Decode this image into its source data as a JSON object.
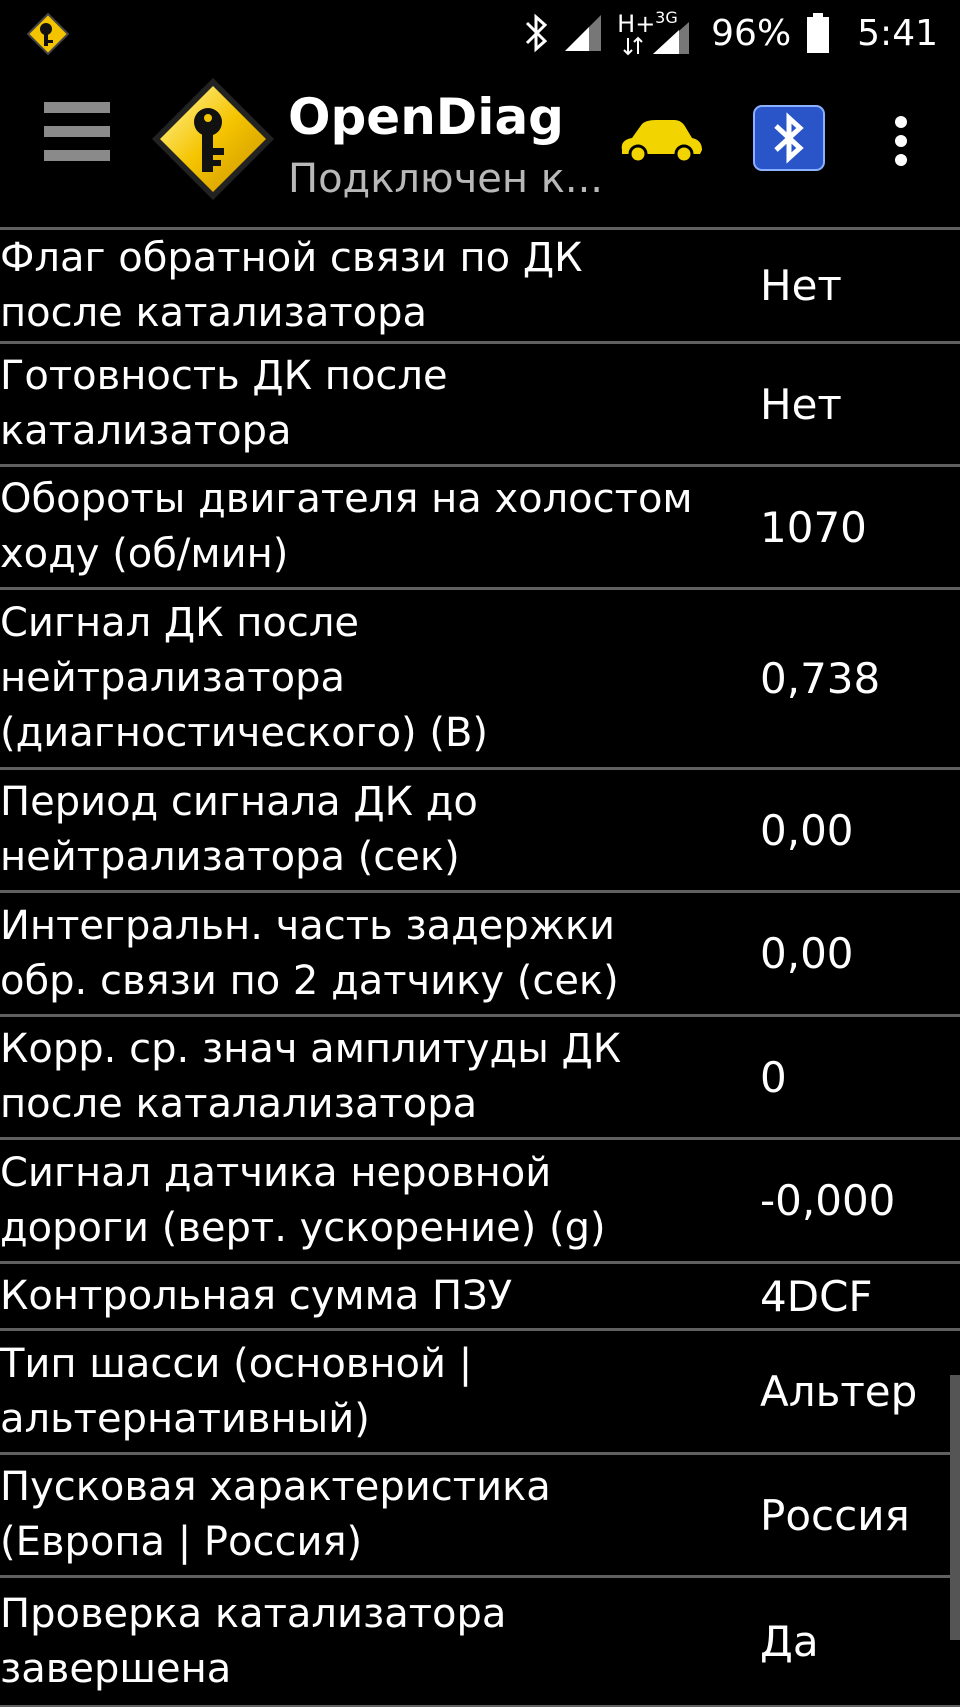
{
  "status_bar": {
    "battery_percent": "96%",
    "time": "5:41",
    "network_label": "H+",
    "network_3g": "3G"
  },
  "action_bar": {
    "title": "OpenDiag",
    "subtitle": "Подключен к..."
  },
  "colors": {
    "background": "#000000",
    "divider": "#606060",
    "car_icon": "#f2d400",
    "logo_yellow": "#f5c400",
    "bluetooth_blue": "#2a55c8"
  },
  "rows": [
    {
      "label": "Флаг обратной связи по ДК\nпосле катализатора",
      "value": "Нет",
      "height": 114
    },
    {
      "label": "Готовность ДК после\nкатализатора",
      "value": "Нет",
      "height": 123
    },
    {
      "label": "Обороты двигателя на холостом\nходу (об/мин)",
      "value": "1070",
      "height": 123
    },
    {
      "label": "Сигнал ДК после\nнейтрализатора\n(диагностического) (В)",
      "value": "0,738",
      "height": 180
    },
    {
      "label": "Период сигнала ДК до\nнейтрализатора (сек)",
      "value": "0,00",
      "height": 123
    },
    {
      "label": "Интегральн. часть задержки\nобр. связи по 2 датчику (сек)",
      "value": "0,00",
      "height": 124
    },
    {
      "label": "Корр. ср. знач амплитуды ДК\nпосле каталализатора",
      "value": "0",
      "height": 123
    },
    {
      "label": "Сигнал датчика неровной\nдороги (верт. ускорение) (g)",
      "value": "-0,000",
      "height": 124
    },
    {
      "label": "Контрольная сумма ПЗУ",
      "value": "4DCF",
      "height": 67
    },
    {
      "label": "Тип шасси (основной |\nальтернативный)",
      "value": "Альтер",
      "height": 124
    },
    {
      "label": "Пусковая характеристика\n(Европа | Россия)",
      "value": "Россия",
      "height": 123
    },
    {
      "label": "Проверка катализатора\nзавершена",
      "value": "Да",
      "height": 130
    }
  ]
}
